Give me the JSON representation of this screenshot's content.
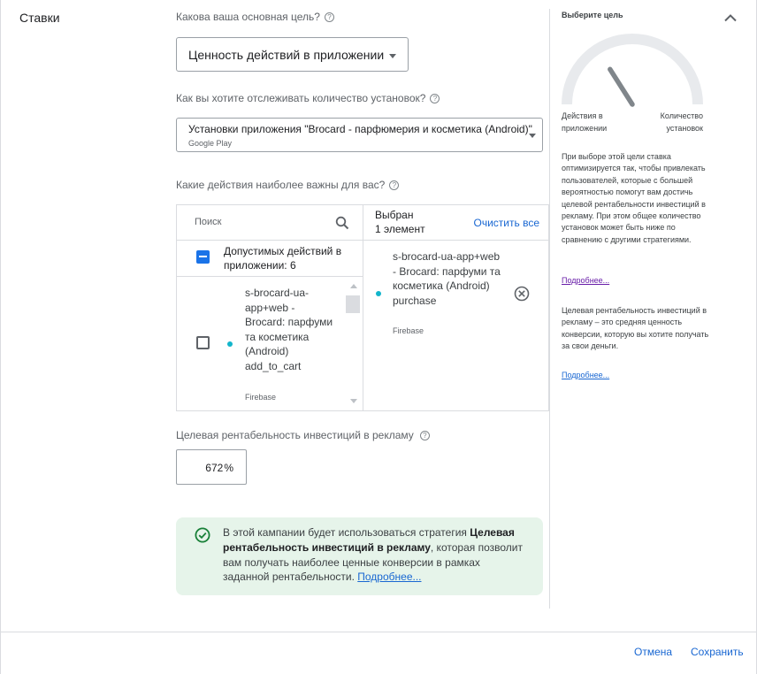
{
  "section": {
    "title": "Ставки"
  },
  "goal": {
    "question": "Какова ваша основная цель?",
    "selected": "Ценность действий в приложении"
  },
  "installs": {
    "question": "Как вы хотите отслеживать количество установок?",
    "selected_main": "Установки приложения \"Brocard - парфюмерия и косметика (Android)\"",
    "selected_sub": "Google Play"
  },
  "actions": {
    "question": "Какие действия наиболее важны для вас?",
    "search_placeholder": "Поиск",
    "all_label": "Допустимых действий в приложении: 6",
    "items": [
      {
        "name": "s-brocard-ua-app+web - Brocard: парфуми та косметика (Android) add_to_cart",
        "source": "Firebase"
      }
    ],
    "selected_header": "Выбран",
    "selected_count": "1 элемент",
    "clear_all": "Очистить все",
    "selected_items": [
      {
        "name": "s-brocard-ua-app+web - Brocard: парфуми та косметика (Android) purchase",
        "source": "Firebase"
      }
    ]
  },
  "roas": {
    "label": "Целевая рентабельность инвестиций в рекламу",
    "value": "672",
    "unit": "%"
  },
  "notice": {
    "text_before": "В этой кампании будет использоваться стратегия ",
    "strategy": "Целевая рентабельность инвестиций в рекламу",
    "text_after": ", которая позволит вам получать наиболее ценные конверсии в рамках заданной рентабельности. ",
    "link": "Подробнее..."
  },
  "sidebar": {
    "title": "Выберите цель",
    "gauge_left": "Действия в приложении",
    "gauge_right": "Количество установок",
    "gauge_position": 0.32,
    "para1": "При выборе этой цели ставка оптимизируется так, чтобы привлекать пользователей, которые с большей вероятностью помогут вам достичь целевой рентабельности инвестиций в рекламу. При этом общее количество установок может быть ниже по сравнению с другими стратегиями.",
    "link1": "Подробнее...",
    "para2": "Целевая рентабельность инвестиций в рекламу – это средняя ценность конверсии, которую вы хотите получать за свои деньги.",
    "link2": "Подробнее..."
  },
  "footer": {
    "cancel": "Отмена",
    "save": "Сохранить"
  },
  "colors": {
    "accent": "#1a73e8",
    "link": "#1967d2",
    "visited_link": "#681da8",
    "event_dot": "#12b5cb",
    "notice_bg": "#e6f4ea",
    "success": "#188038"
  }
}
